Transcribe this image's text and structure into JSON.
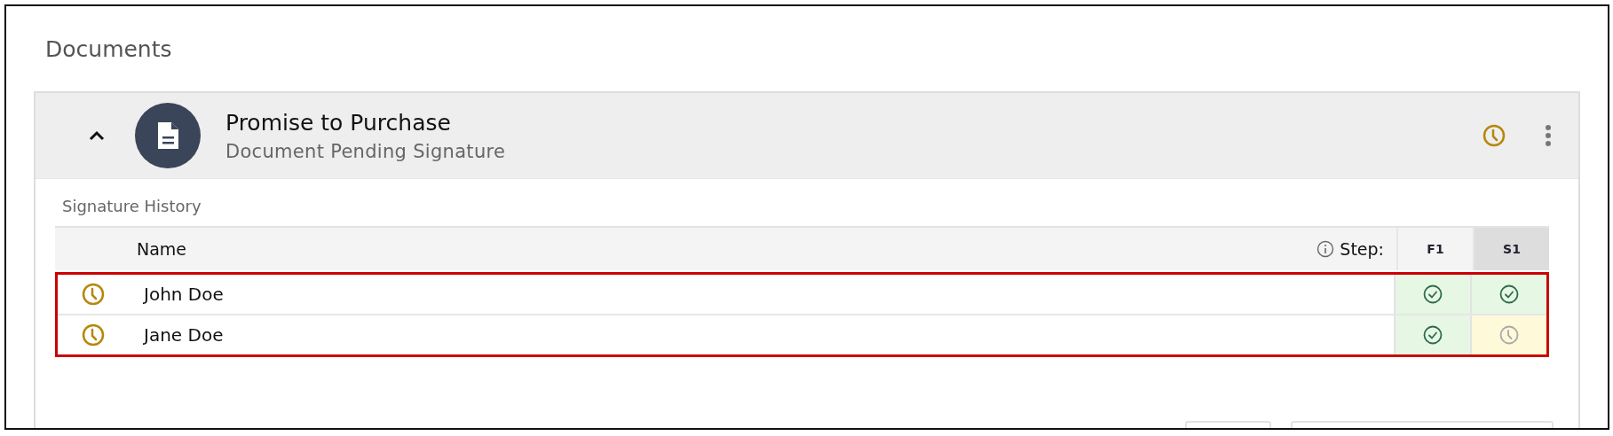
{
  "section_title": "Documents",
  "document": {
    "expanded": true,
    "title": "Promise to Purchase",
    "status": "Document Pending Signature",
    "pending": true
  },
  "history": {
    "title": "Signature History",
    "name_column": "Name",
    "step_label": "Step:",
    "steps": [
      {
        "label": "F1",
        "selected": false
      },
      {
        "label": "S1",
        "selected": true
      }
    ],
    "highlighted": true,
    "rows": [
      {
        "name": "John Doe",
        "pending": true,
        "steps": [
          {
            "signed": true
          },
          {
            "signed": true
          }
        ]
      },
      {
        "name": "Jane Doe",
        "pending": true,
        "steps": [
          {
            "signed": true
          },
          {
            "signed": false
          }
        ]
      }
    ]
  }
}
